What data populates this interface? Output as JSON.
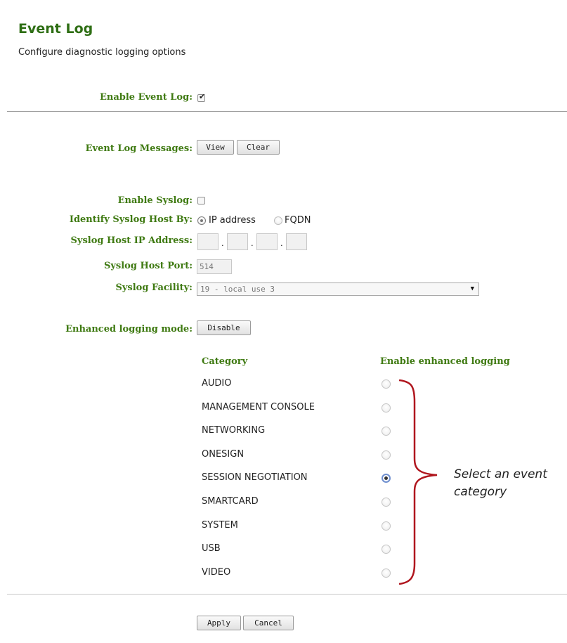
{
  "page": {
    "title": "Event Log",
    "subtitle": "Configure diagnostic logging options"
  },
  "enable_event_log": {
    "label": "Enable Event Log:",
    "checked": true
  },
  "event_log_messages": {
    "label": "Event Log Messages:",
    "view_label": "View",
    "clear_label": "Clear"
  },
  "enable_syslog": {
    "label": "Enable Syslog:",
    "checked": false
  },
  "identify_host": {
    "label": "Identify Syslog Host By:",
    "options": [
      "IP address",
      "FQDN"
    ],
    "selected": "IP address"
  },
  "syslog_ip": {
    "label": "Syslog Host IP Address:",
    "octets": [
      "",
      "",
      "",
      ""
    ]
  },
  "syslog_port": {
    "label": "Syslog Host Port:",
    "value": "514"
  },
  "syslog_facility": {
    "label": "Syslog Facility:",
    "value": "19 - local use 3"
  },
  "enhanced_logging": {
    "label": "Enhanced logging mode:",
    "button_label": "Disable"
  },
  "categories": {
    "header_category": "Category",
    "header_enable": "Enable enhanced logging",
    "items": [
      {
        "name": "AUDIO",
        "selected": false
      },
      {
        "name": "MANAGEMENT CONSOLE",
        "selected": false
      },
      {
        "name": "NETWORKING",
        "selected": false
      },
      {
        "name": "ONESIGN",
        "selected": false
      },
      {
        "name": "SESSION NEGOTIATION",
        "selected": true
      },
      {
        "name": "SMARTCARD",
        "selected": false
      },
      {
        "name": "SYSTEM",
        "selected": false
      },
      {
        "name": "USB",
        "selected": false
      },
      {
        "name": "VIDEO",
        "selected": false
      }
    ]
  },
  "callout": {
    "line1": "Select an event",
    "line2": "category",
    "color": "#b0161e"
  },
  "footer": {
    "apply_label": "Apply",
    "cancel_label": "Cancel"
  },
  "colors": {
    "label_green": "#3f7a12",
    "title_green": "#2e6e14"
  }
}
